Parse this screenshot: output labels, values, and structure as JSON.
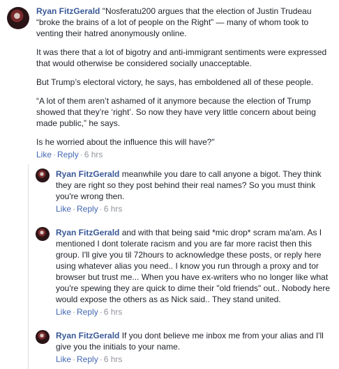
{
  "main_comment": {
    "author": "Ryan FitzGerald",
    "paragraphs": [
      "\"Nosferatu200 argues that the election of Justin Trudeau “broke the brains of a lot of people on the Right” — many of whom took to venting their hatred anonymously online.",
      "It was there that a lot of bigotry and anti-immigrant sentiments were expressed that would otherwise be considered socially unacceptable.",
      "But Trump’s electoral victory, he says, has emboldened all of these people.",
      "“A lot of them aren’t ashamed of it anymore because the election of Trump showed that they’re ‘right’. So now they have very little concern about being made public,” he says.",
      "Is he worried about the influence this will have?\""
    ],
    "like_label": "Like",
    "reply_label": "Reply",
    "time": "6 hrs"
  },
  "replies": [
    {
      "author": "Ryan FitzGerald",
      "text": "meanwhile you dare to call anyone a bigot. They think they are right so they post behind their real names? So you must think you're wrong then.",
      "like_label": "Like",
      "reply_label": "Reply",
      "time": "6 hrs"
    },
    {
      "author": "Ryan FitzGerald",
      "text": "and with that being said *mic drop* scram ma'am. As I mentioned I dont tolerate racism and you are far more racist then this group. I'll give you til 72hours to acknowledge these posts, or reply here using whatever alias you need.. I know you run through a proxy and tor browser but trust me... When you have ex-writers who no longer like what you're spewing they are quick to dime their \"old friends\" out.. Nobody here would expose the others as as Nick said.. They stand united.",
      "like_label": "Like",
      "reply_label": "Reply",
      "time": "6 hrs"
    },
    {
      "author": "Ryan FitzGerald",
      "text": "If you dont believe me inbox me from your alias and I'll give you the initials to your name.",
      "like_label": "Like",
      "reply_label": "Reply",
      "time": "6 hrs"
    }
  ]
}
